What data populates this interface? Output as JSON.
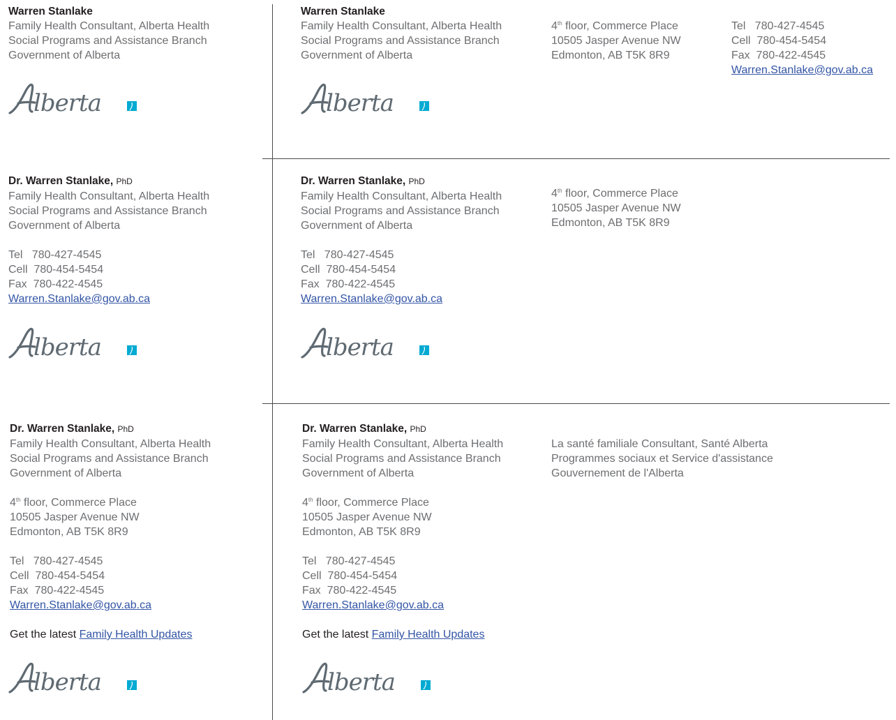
{
  "name": "Warren Stanlake",
  "name_dr": "Dr. Warren Stanlake,",
  "credential": "PhD",
  "title_lines": [
    "Family Health Consultant, Alberta Health",
    "Social Programs and Assistance Branch",
    "Government of Alberta"
  ],
  "address": {
    "floor_num": "4",
    "floor_sup": "th",
    "floor_rest": " floor, Commerce Place",
    "street": "10505 Jasper Avenue NW",
    "city": "Edmonton, AB  T5K 8R9"
  },
  "contact": {
    "tel": "Tel   780-427-4545",
    "cell": "Cell  780-454-5454",
    "fax": "Fax  780-422-4545",
    "email": "Warren.Stanlake@gov.ab.ca"
  },
  "updates": {
    "prefix": "Get the latest ",
    "link": "Family Health Updates"
  },
  "french_lines": [
    "La santé familiale Consultant, Santé Alberta",
    "Programmes sociaux et Service d'assistance",
    "Gouvernement de l'Alberta"
  ],
  "logo": {
    "text": "Alberta",
    "color": "#5f6a72",
    "accent": "#00aad2"
  }
}
